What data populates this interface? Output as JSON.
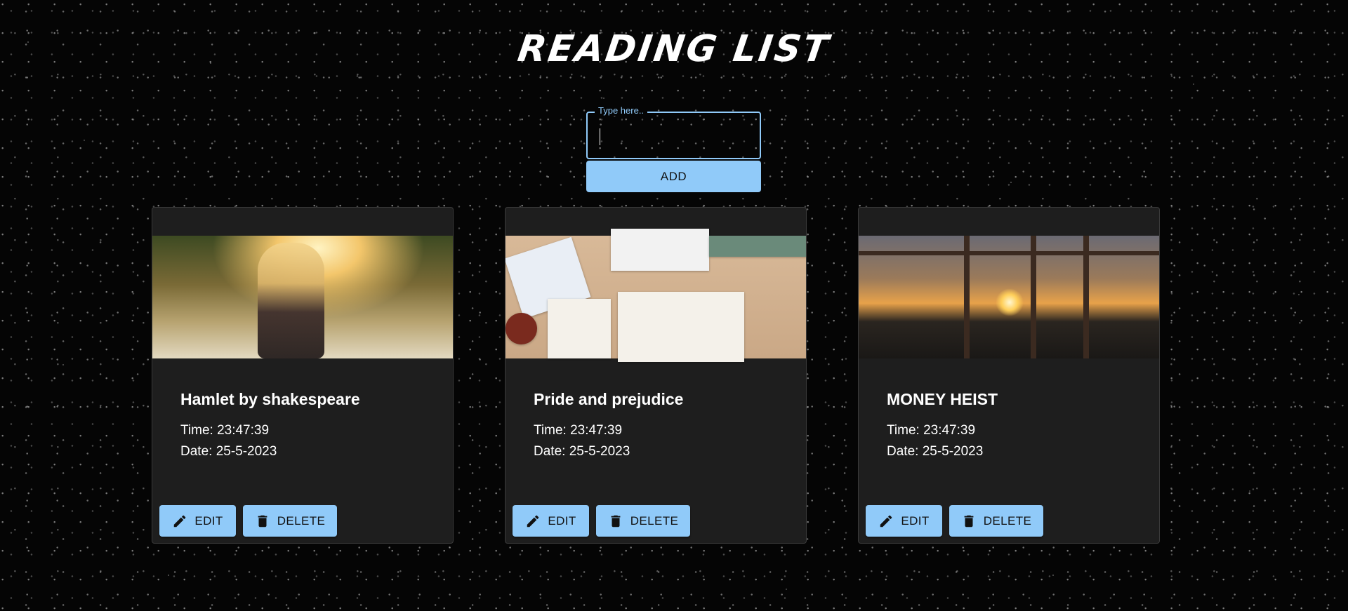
{
  "header": {
    "title": "READING LIST"
  },
  "input": {
    "label": "Type here..",
    "value": ""
  },
  "add_button": {
    "label": "ADD"
  },
  "cards": [
    {
      "title": "Hamlet by shakespeare",
      "time": "Time: 23:47:39",
      "date": "Date: 25-5-2023",
      "edit_label": "EDIT",
      "delete_label": "DELETE"
    },
    {
      "title": "Pride and prejudice",
      "time": "Time: 23:47:39",
      "date": "Date: 25-5-2023",
      "edit_label": "EDIT",
      "delete_label": "DELETE"
    },
    {
      "title": "MONEY HEIST",
      "time": "Time: 23:47:39",
      "date": "Date: 25-5-2023",
      "edit_label": "EDIT",
      "delete_label": "DELETE"
    }
  ],
  "icons": {
    "edit": "pencil-icon",
    "delete": "trash-icon"
  },
  "colors": {
    "accent": "#90caf9",
    "card_background": "#1e1e1e",
    "page_background": "#050505"
  }
}
